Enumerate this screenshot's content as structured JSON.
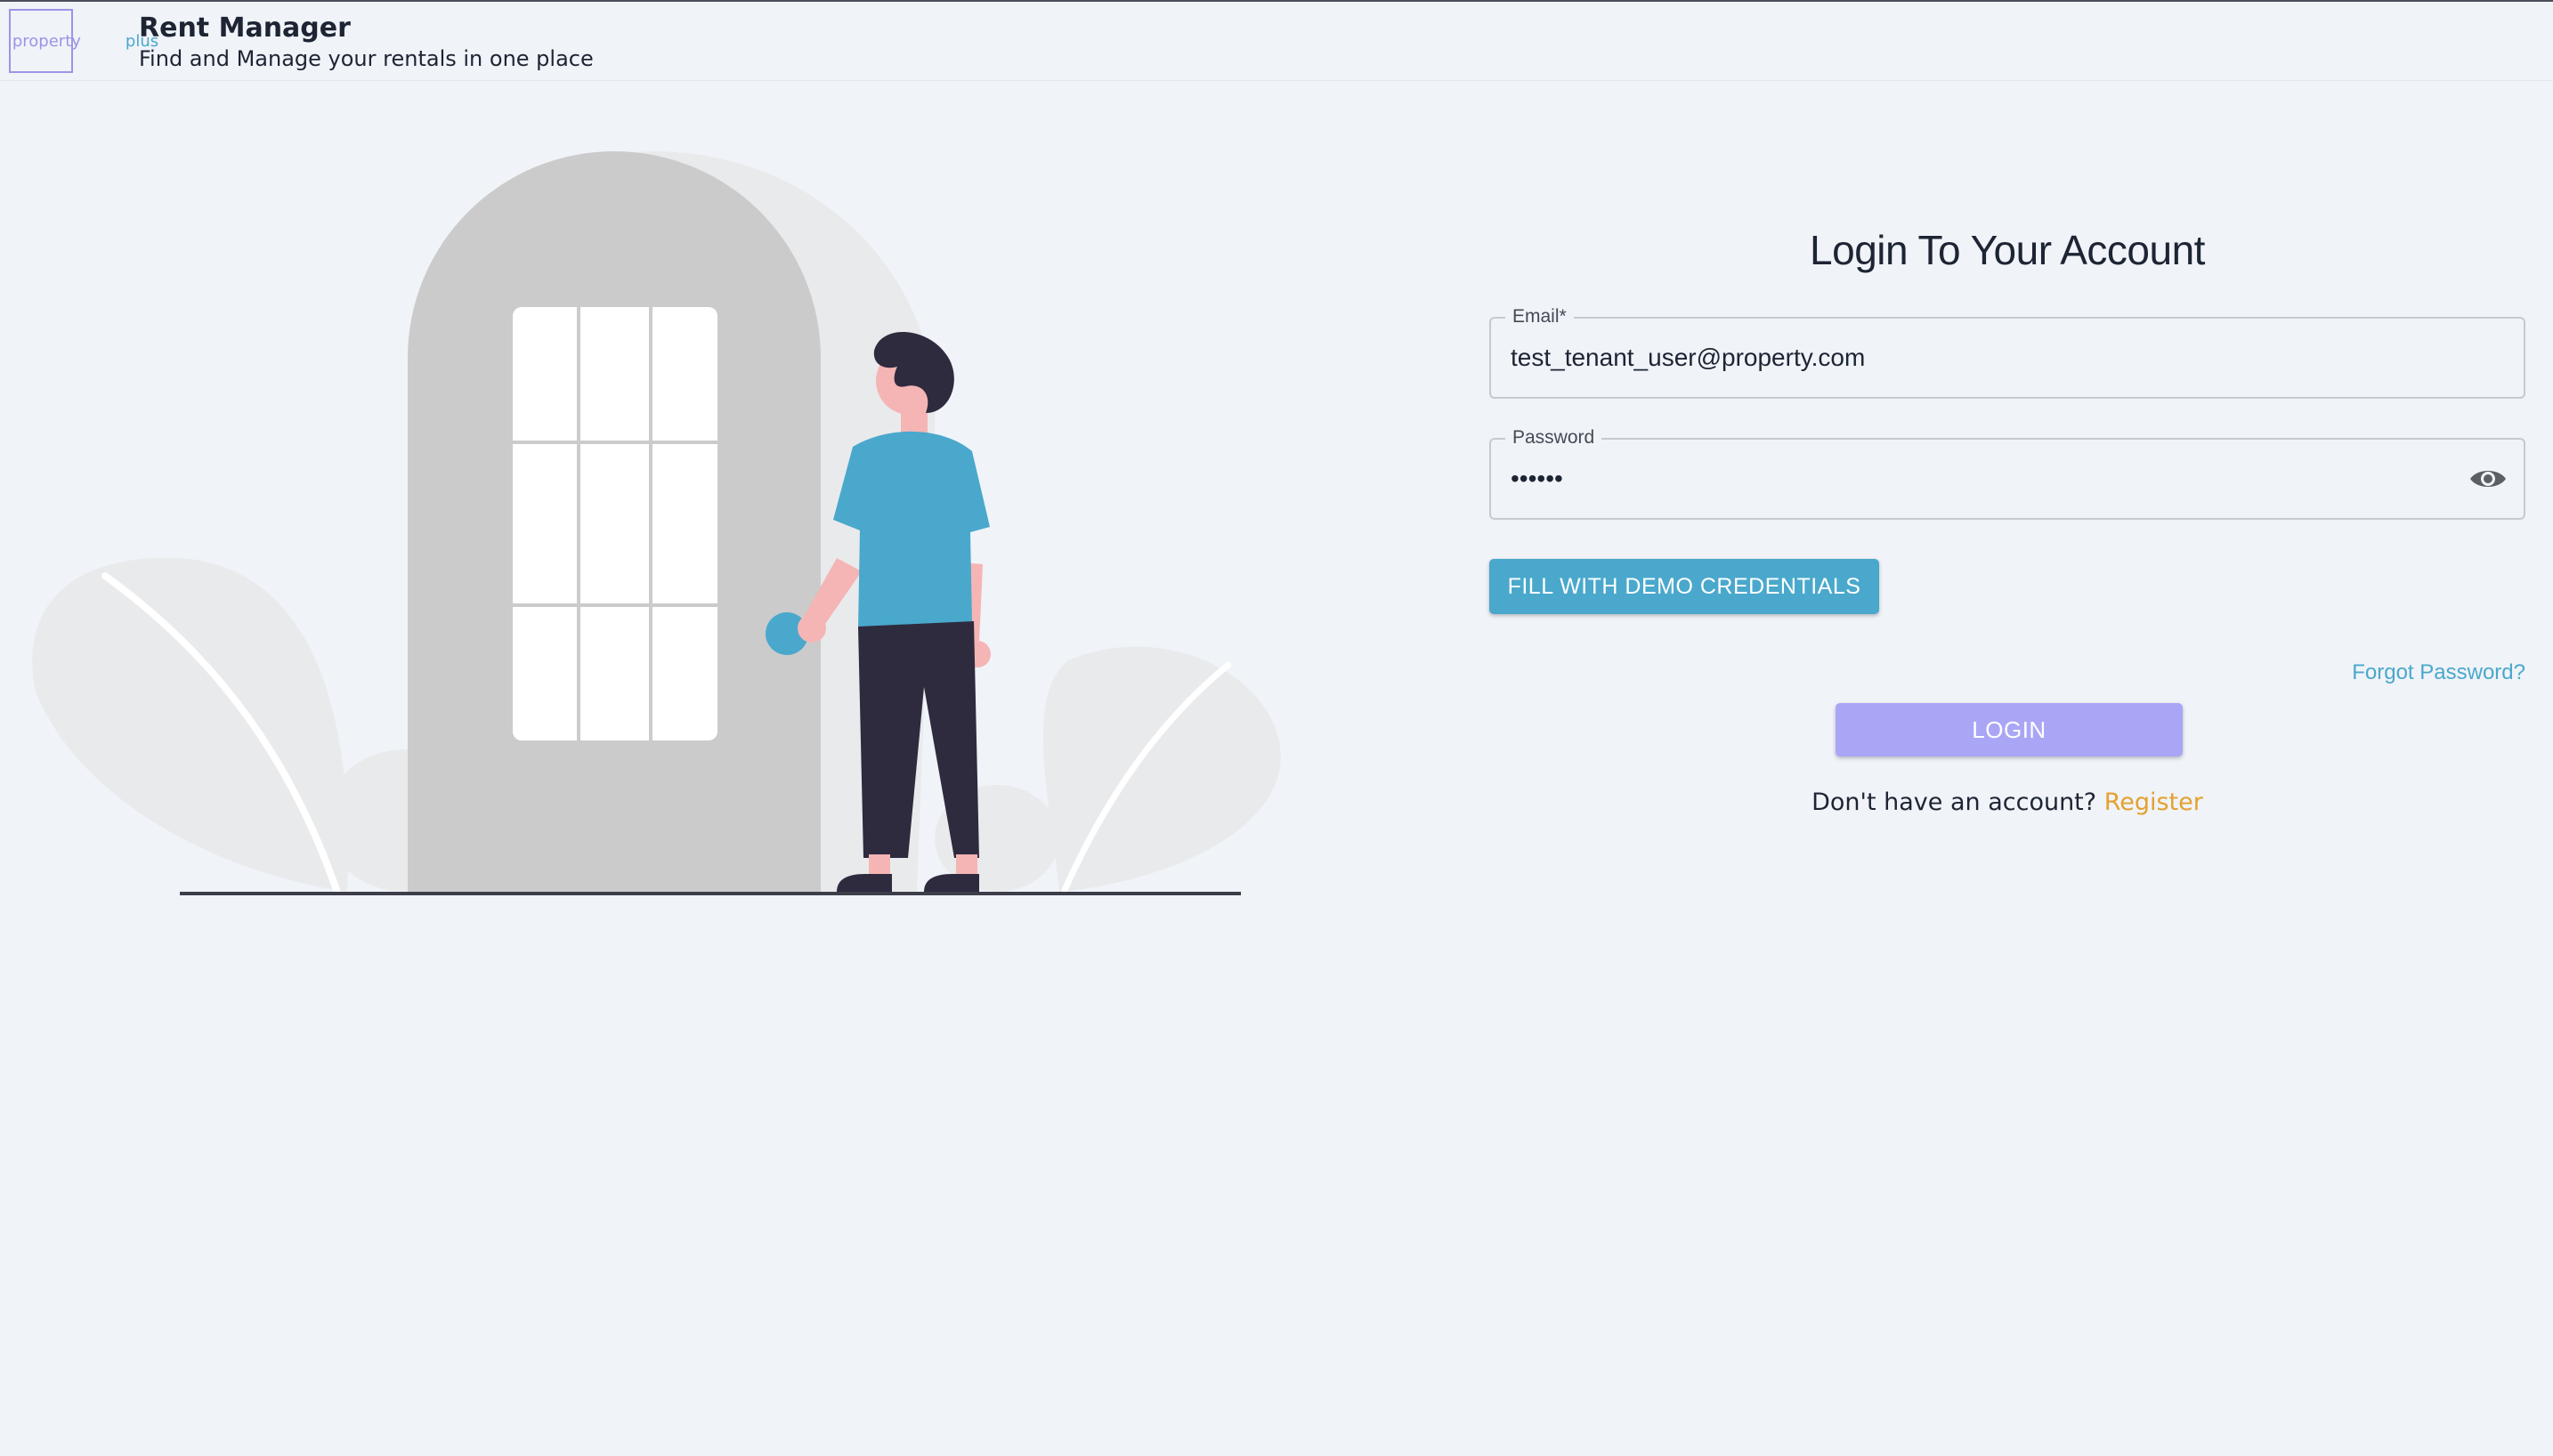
{
  "header": {
    "logo_part1": "property",
    "logo_part2": "plus",
    "title": "Rent Manager",
    "subtitle": "Find and Manage your rentals in one place"
  },
  "login_form": {
    "title": "Login To Your Account",
    "email": {
      "label": "Email",
      "required_marker": "*",
      "value": "test_tenant_user@property.com"
    },
    "password": {
      "label": "Password",
      "value": "••••••",
      "toggle_icon": "eye-icon"
    },
    "demo_button_label": "Fill with demo credentials",
    "forgot_password_label": "Forgot Password?",
    "login_button_label": "Login",
    "register_prompt": "Don't have an account? ",
    "register_link_label": "Register"
  },
  "colors": {
    "background": "#f0f3f8",
    "primary_blue": "#4aa8cc",
    "login_purple": "#aaa6f6",
    "register_orange": "#e3a12f",
    "text_dark": "#1d2433"
  }
}
